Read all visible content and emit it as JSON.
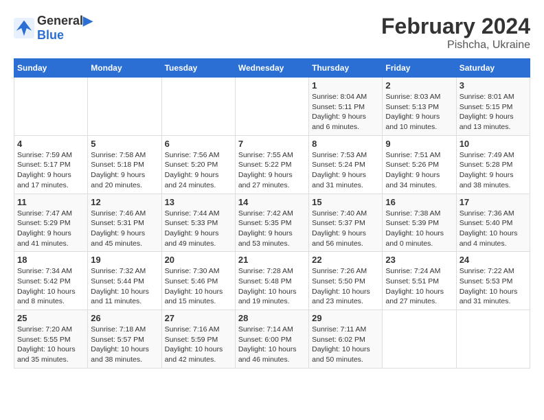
{
  "header": {
    "logo_line1": "General",
    "logo_line2": "Blue",
    "title": "February 2024",
    "subtitle": "Pishcha, Ukraine"
  },
  "days_of_week": [
    "Sunday",
    "Monday",
    "Tuesday",
    "Wednesday",
    "Thursday",
    "Friday",
    "Saturday"
  ],
  "weeks": [
    {
      "cells": [
        {
          "day": "",
          "info": ""
        },
        {
          "day": "",
          "info": ""
        },
        {
          "day": "",
          "info": ""
        },
        {
          "day": "",
          "info": ""
        },
        {
          "day": "1",
          "info": "Sunrise: 8:04 AM\nSunset: 5:11 PM\nDaylight: 9 hours\nand 6 minutes."
        },
        {
          "day": "2",
          "info": "Sunrise: 8:03 AM\nSunset: 5:13 PM\nDaylight: 9 hours\nand 10 minutes."
        },
        {
          "day": "3",
          "info": "Sunrise: 8:01 AM\nSunset: 5:15 PM\nDaylight: 9 hours\nand 13 minutes."
        }
      ]
    },
    {
      "cells": [
        {
          "day": "4",
          "info": "Sunrise: 7:59 AM\nSunset: 5:17 PM\nDaylight: 9 hours\nand 17 minutes."
        },
        {
          "day": "5",
          "info": "Sunrise: 7:58 AM\nSunset: 5:18 PM\nDaylight: 9 hours\nand 20 minutes."
        },
        {
          "day": "6",
          "info": "Sunrise: 7:56 AM\nSunset: 5:20 PM\nDaylight: 9 hours\nand 24 minutes."
        },
        {
          "day": "7",
          "info": "Sunrise: 7:55 AM\nSunset: 5:22 PM\nDaylight: 9 hours\nand 27 minutes."
        },
        {
          "day": "8",
          "info": "Sunrise: 7:53 AM\nSunset: 5:24 PM\nDaylight: 9 hours\nand 31 minutes."
        },
        {
          "day": "9",
          "info": "Sunrise: 7:51 AM\nSunset: 5:26 PM\nDaylight: 9 hours\nand 34 minutes."
        },
        {
          "day": "10",
          "info": "Sunrise: 7:49 AM\nSunset: 5:28 PM\nDaylight: 9 hours\nand 38 minutes."
        }
      ]
    },
    {
      "cells": [
        {
          "day": "11",
          "info": "Sunrise: 7:47 AM\nSunset: 5:29 PM\nDaylight: 9 hours\nand 41 minutes."
        },
        {
          "day": "12",
          "info": "Sunrise: 7:46 AM\nSunset: 5:31 PM\nDaylight: 9 hours\nand 45 minutes."
        },
        {
          "day": "13",
          "info": "Sunrise: 7:44 AM\nSunset: 5:33 PM\nDaylight: 9 hours\nand 49 minutes."
        },
        {
          "day": "14",
          "info": "Sunrise: 7:42 AM\nSunset: 5:35 PM\nDaylight: 9 hours\nand 53 minutes."
        },
        {
          "day": "15",
          "info": "Sunrise: 7:40 AM\nSunset: 5:37 PM\nDaylight: 9 hours\nand 56 minutes."
        },
        {
          "day": "16",
          "info": "Sunrise: 7:38 AM\nSunset: 5:39 PM\nDaylight: 10 hours\nand 0 minutes."
        },
        {
          "day": "17",
          "info": "Sunrise: 7:36 AM\nSunset: 5:40 PM\nDaylight: 10 hours\nand 4 minutes."
        }
      ]
    },
    {
      "cells": [
        {
          "day": "18",
          "info": "Sunrise: 7:34 AM\nSunset: 5:42 PM\nDaylight: 10 hours\nand 8 minutes."
        },
        {
          "day": "19",
          "info": "Sunrise: 7:32 AM\nSunset: 5:44 PM\nDaylight: 10 hours\nand 11 minutes."
        },
        {
          "day": "20",
          "info": "Sunrise: 7:30 AM\nSunset: 5:46 PM\nDaylight: 10 hours\nand 15 minutes."
        },
        {
          "day": "21",
          "info": "Sunrise: 7:28 AM\nSunset: 5:48 PM\nDaylight: 10 hours\nand 19 minutes."
        },
        {
          "day": "22",
          "info": "Sunrise: 7:26 AM\nSunset: 5:50 PM\nDaylight: 10 hours\nand 23 minutes."
        },
        {
          "day": "23",
          "info": "Sunrise: 7:24 AM\nSunset: 5:51 PM\nDaylight: 10 hours\nand 27 minutes."
        },
        {
          "day": "24",
          "info": "Sunrise: 7:22 AM\nSunset: 5:53 PM\nDaylight: 10 hours\nand 31 minutes."
        }
      ]
    },
    {
      "cells": [
        {
          "day": "25",
          "info": "Sunrise: 7:20 AM\nSunset: 5:55 PM\nDaylight: 10 hours\nand 35 minutes."
        },
        {
          "day": "26",
          "info": "Sunrise: 7:18 AM\nSunset: 5:57 PM\nDaylight: 10 hours\nand 38 minutes."
        },
        {
          "day": "27",
          "info": "Sunrise: 7:16 AM\nSunset: 5:59 PM\nDaylight: 10 hours\nand 42 minutes."
        },
        {
          "day": "28",
          "info": "Sunrise: 7:14 AM\nSunset: 6:00 PM\nDaylight: 10 hours\nand 46 minutes."
        },
        {
          "day": "29",
          "info": "Sunrise: 7:11 AM\nSunset: 6:02 PM\nDaylight: 10 hours\nand 50 minutes."
        },
        {
          "day": "",
          "info": ""
        },
        {
          "day": "",
          "info": ""
        }
      ]
    }
  ]
}
